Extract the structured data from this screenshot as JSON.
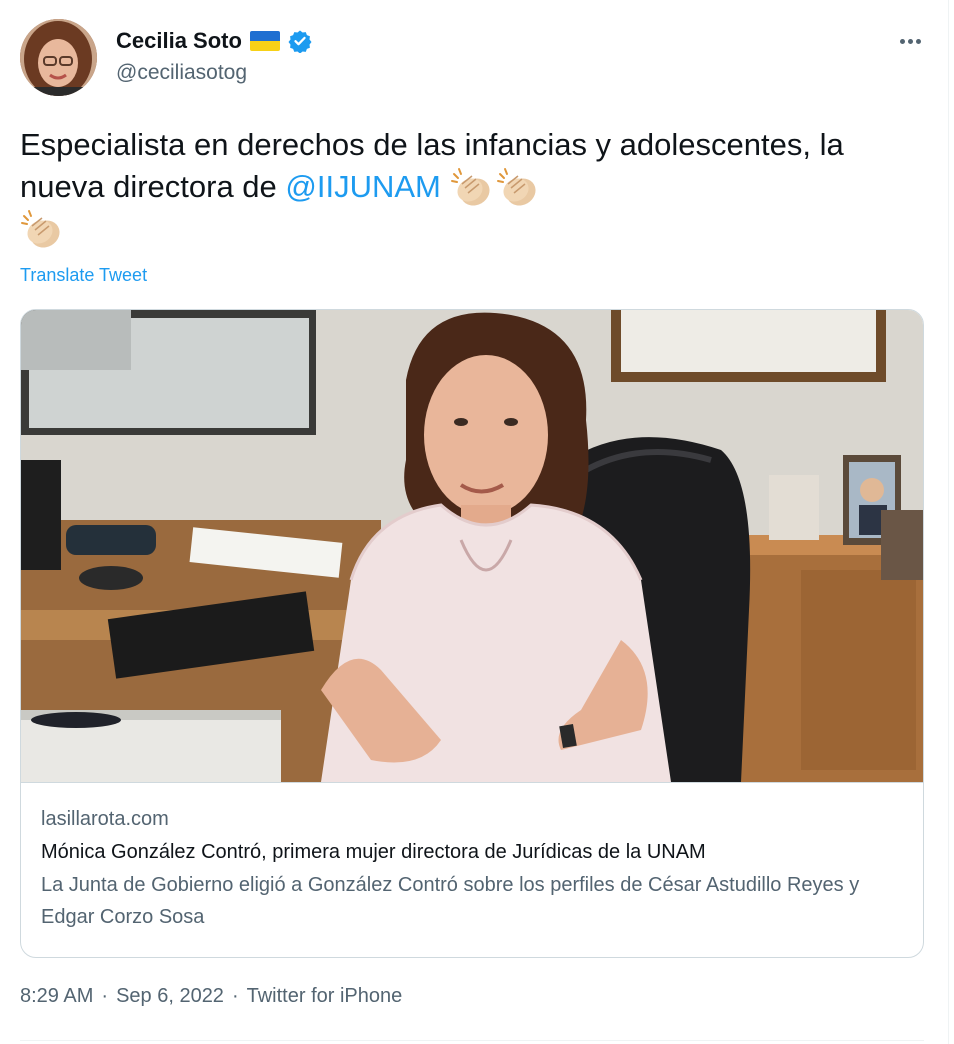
{
  "author": {
    "display_name": "Cecilia Soto",
    "handle": "@ceciliasotog",
    "flag_icon": "ukraine-flag-icon",
    "verified_icon": "verified-badge-icon"
  },
  "tweet": {
    "text_before": "Especialista en derechos de las infancias y adolescentes, la nueva directora de ",
    "mention": "@IIJUNAM",
    "emoji_icon": "clapping-hands-icon",
    "translate_label": "Translate Tweet"
  },
  "card": {
    "image_icon": "article-photo",
    "domain": "lasillarota.com",
    "title": "Mónica González Contró, primera mujer directora de Jurídicas de la UNAM",
    "description": "La Junta de Gobierno eligió a González Contró  sobre los perfiles de César Astudillo Reyes y Edgar Corzo Sosa"
  },
  "meta": {
    "time": "8:29 AM",
    "separator": "·",
    "date": "Sep 6, 2022",
    "source": "Twitter for iPhone"
  },
  "colors": {
    "accent": "#1d9bf0",
    "text": "#0f1419",
    "secondary": "#536471",
    "border": "#cfd9de"
  }
}
